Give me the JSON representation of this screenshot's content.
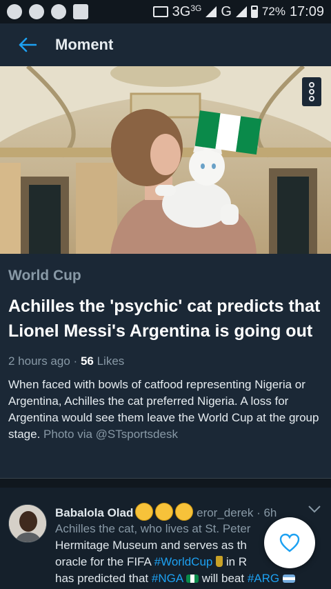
{
  "status_bar": {
    "network_label": "3G",
    "network_super": "3G",
    "network2_label": "G",
    "battery": "72%",
    "time": "17:09"
  },
  "app_bar": {
    "title": "Moment",
    "back_icon": "arrow-left-icon"
  },
  "hero": {
    "overflow_icon": "more-vertical-icon"
  },
  "card": {
    "category": "World Cup",
    "headline": "Achilles the 'psychic' cat predicts that Lionel Messi's Argentina is going out",
    "time_ago": "2 hours ago",
    "separator": "·",
    "likes_count": "56",
    "likes_label": "Likes",
    "description": "When faced with bowls of catfood representing Nigeria or Argentina, Achilles the cat preferred Nigeria. A loss for Argentina would see them leave the World Cup at the group stage.",
    "credit": "Photo via @STsportsdesk"
  },
  "tweet": {
    "display_name": "Babalola Olad",
    "handle": "eror_derek",
    "dot": "·",
    "time": "6h",
    "line1_a": "Achilles the cat, who lives at St. Peter",
    "line2_a": "Hermitage Museum and serves as th",
    "line3_a": "oracle for the FIFA ",
    "hashtag_worldcup": "#WorldCup",
    "line3_b": " in R",
    "line4_a": "has predicted that ",
    "hashtag_nga": "#NGA",
    "line4_b": " will beat ",
    "hashtag_arg": "#ARG"
  },
  "fab": {
    "icon": "heart-icon"
  },
  "colors": {
    "accent": "#1da1f2",
    "card_bg": "#1b2836",
    "page_bg": "#15202b",
    "muted": "#8899a6"
  }
}
